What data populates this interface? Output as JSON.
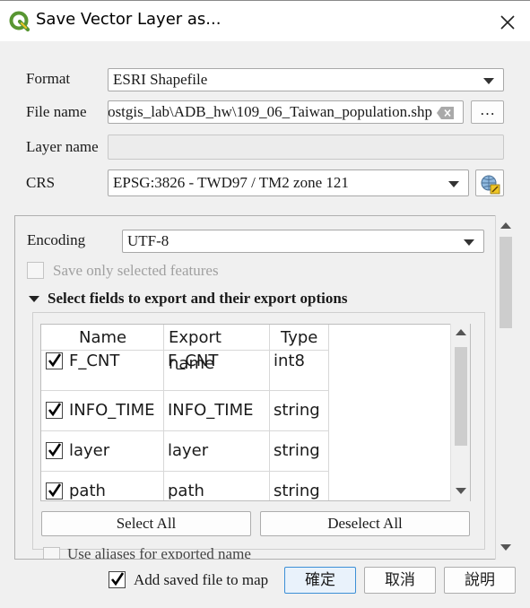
{
  "window": {
    "title": "Save Vector Layer as..."
  },
  "form": {
    "format_label": "Format",
    "format_value": "ESRI Shapefile",
    "filename_label": "File name",
    "filename_value": "ostgis_lab\\ADB_hw\\109_06_Taiwan_population.shp",
    "browse_label": "…",
    "layername_label": "Layer name",
    "layername_value": "",
    "crs_label": "CRS",
    "crs_value": "EPSG:3826 - TWD97 / TM2 zone 121"
  },
  "options": {
    "encoding_label": "Encoding",
    "encoding_value": "UTF-8",
    "save_selected_label": "Save only selected features",
    "fields_section_label": "Select fields to export and their export options",
    "columns": [
      "Name",
      "Export name",
      "Type"
    ],
    "rows": [
      {
        "name": "F_CNT",
        "export_name": "F_CNT",
        "type": "int8",
        "checked": true
      },
      {
        "name": "INFO_TIME",
        "export_name": "INFO_TIME",
        "type": "string",
        "checked": true
      },
      {
        "name": "layer",
        "export_name": "layer",
        "type": "string",
        "checked": true
      },
      {
        "name": "path",
        "export_name": "path",
        "type": "string",
        "checked": true
      }
    ],
    "select_all_label": "Select All",
    "deselect_all_label": "Deselect All",
    "use_aliases_label": "Use aliases for exported name"
  },
  "footer": {
    "add_to_map_label": "Add saved file to map",
    "add_to_map_checked": true,
    "ok_label": "確定",
    "cancel_label": "取消",
    "help_label": "說明"
  },
  "colors": {
    "accent": "#3c8fd6",
    "qgis_green": "#589632",
    "qgis_yellow": "#eec526"
  }
}
